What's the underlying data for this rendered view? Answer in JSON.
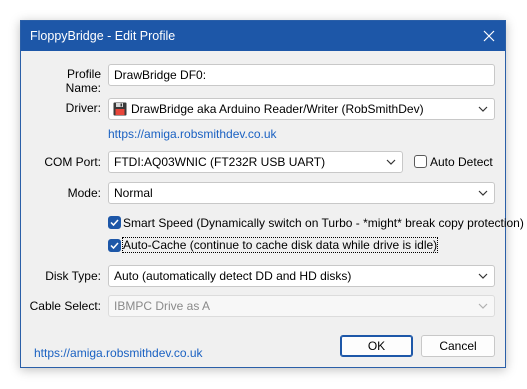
{
  "window": {
    "title": "FloppyBridge - Edit Profile"
  },
  "profile": {
    "label": "Profile Name:",
    "value": "DrawBridge DF0:"
  },
  "driver": {
    "label": "Driver:",
    "value": "DrawBridge aka Arduino Reader/Writer (RobSmithDev)",
    "icon": "floppy-disk-icon",
    "link": "https://amiga.robsmithdev.co.uk"
  },
  "com_port": {
    "label": "COM Port:",
    "value": "FTDI:AQ03WNIC (FT232R USB UART)",
    "auto_detect": {
      "label": "Auto Detect",
      "checked": false
    }
  },
  "mode": {
    "label": "Mode:",
    "value": "Normal"
  },
  "smart_speed": {
    "label": "Smart Speed (Dynamically switch on Turbo - *might* break copy protection)",
    "checked": true
  },
  "auto_cache": {
    "label": "Auto-Cache (continue to cache disk data while drive is idle)",
    "checked": true
  },
  "disk_type": {
    "label": "Disk Type:",
    "value": "Auto (automatically detect DD and HD disks)"
  },
  "cable_select": {
    "label": "Cable Select:",
    "value": "IBMPC Drive as A"
  },
  "footer": {
    "link": "https://amiga.robsmithdev.co.uk",
    "ok_label": "OK",
    "cancel_label": "Cancel"
  },
  "colors": {
    "titlebar": "#1d57a8",
    "accent": "#1d57a8",
    "link": "#1a61c2"
  }
}
